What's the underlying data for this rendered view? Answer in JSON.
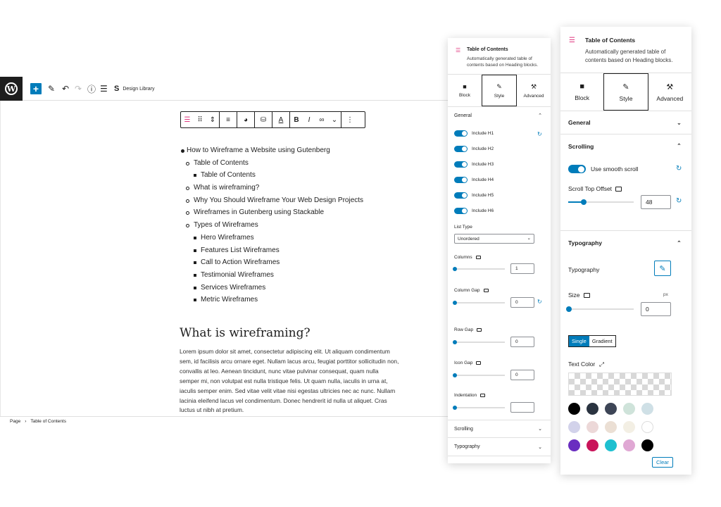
{
  "editor": {
    "logo_letter": "W",
    "add_label": "+",
    "toolbar_icons": [
      "pencil-icon",
      "undo-icon",
      "redo-icon",
      "info-icon",
      "list-view-icon"
    ],
    "design_library_label": "Design Library",
    "toc_items": [
      {
        "level": 1,
        "text": "How to Wireframe a Website using Gutenberg"
      },
      {
        "level": 2,
        "text": "Table of Contents"
      },
      {
        "level": 3,
        "text": "Table of Contents"
      },
      {
        "level": 2,
        "text": "What is wireframing?"
      },
      {
        "level": 2,
        "text": "Why You Should Wireframe Your Web Design Projects"
      },
      {
        "level": 2,
        "text": "Wireframes in Gutenberg using Stackable"
      },
      {
        "level": 2,
        "text": "Types of Wireframes"
      },
      {
        "level": 3,
        "text": "Hero Wireframes"
      },
      {
        "level": 3,
        "text": "Features List Wireframes"
      },
      {
        "level": 3,
        "text": "Call to Action Wireframes"
      },
      {
        "level": 3,
        "text": "Testimonial Wireframes"
      },
      {
        "level": 3,
        "text": "Services Wireframes"
      },
      {
        "level": 3,
        "text": "Metric Wireframes"
      }
    ],
    "heading": "What is wireframing?",
    "paragraph": "Lorem ipsum dolor sit amet, consectetur adipiscing elit. Ut aliquam condimentum sem, id facilisis arcu ornare eget. Nullam lacus arcu, feugiat porttitor sollicitudin non, convallis at leo. Aenean tincidunt, nunc vitae pulvinar consequat, quam nulla semper mi, non volutpat est nulla tristique felis. Ut quam nulla, iaculis in urna at, iaculis semper enim. Sed vitae velit vitae nisi egestas ultricies nec ac nunc. Nullam lacinia eleifend lacus vel condimentum. Donec hendrerit id nulla ut aliquet. Cras luctus ut nibh at pretium.",
    "breadcrumb": [
      "Page",
      "Table of Contents"
    ]
  },
  "panel_mid": {
    "title": "Table of Contents",
    "description": "Automatically generated table of contents based on Heading blocks.",
    "tabs": [
      {
        "label": "Block",
        "icon": "block-icon"
      },
      {
        "label": "Style",
        "icon": "brush-icon"
      },
      {
        "label": "Advanced",
        "icon": "wrench-icon"
      }
    ],
    "general_label": "General",
    "includes": [
      "Include H1",
      "Include H2",
      "Include H3",
      "Include H4",
      "Include H5",
      "Include H6"
    ],
    "list_type_label": "List Type",
    "list_type_value": "Unordered",
    "columns_label": "Columns",
    "columns_value": "1",
    "column_gap_label": "Column Gap",
    "column_gap_value": "0",
    "row_gap_label": "Row Gap",
    "row_gap_value": "0",
    "icon_gap_label": "Icon Gap",
    "icon_gap_value": "0",
    "indentation_label": "Indentation",
    "indentation_value": "",
    "scrolling_label": "Scrolling",
    "typography_label": "Typography"
  },
  "panel_right": {
    "title": "Table of Contents",
    "description": "Automatically generated table of contents based on Heading blocks.",
    "tabs": [
      {
        "label": "Block",
        "icon": "block-icon"
      },
      {
        "label": "Style",
        "icon": "brush-icon"
      },
      {
        "label": "Advanced",
        "icon": "wrench-icon"
      }
    ],
    "general_label": "General",
    "scrolling_label": "Scrolling",
    "smooth_scroll_label": "Use smooth scroll",
    "scroll_offset_label": "Scroll Top Offset",
    "scroll_offset_value": "48",
    "typography_section_label": "Typography",
    "typography_label": "Typography",
    "size_label": "Size",
    "size_unit": "px",
    "size_value": "0",
    "color_type_single": "Single",
    "color_type_gradient": "Gradient",
    "text_color_label": "Text Color",
    "swatches": [
      "#000000",
      "#2a3340",
      "#3d4556",
      "#cfe3da",
      "#cfe0e6",
      "#d2d2ea",
      "#ecd8d8",
      "#ebdfd4",
      "#f3efe4",
      "#ffffff",
      "#6a2ec0",
      "#c9145a",
      "#1ec0d0",
      "#e0a8d4",
      "#000000"
    ],
    "clear_label": "Clear"
  }
}
